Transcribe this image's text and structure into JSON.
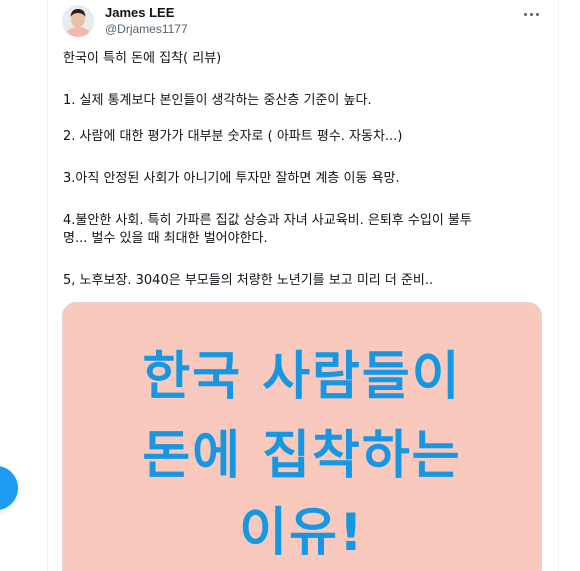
{
  "author": {
    "name": "James LEE",
    "handle": "@Drjames1177"
  },
  "tweet": {
    "title": "한국이 특히 돈에 집착( 리뷰)",
    "point1": "1. 실제 통계보다 본인들이 생각하는 중산층 기준이 높다.",
    "point2": "2. 사람에 대한 평가가 대부분 숫자로 ( 아파트 평수. 자동차...)",
    "point3": "3.아직 안정된 사회가 아니기에 투자만 잘하면 계층 이동 욕망.",
    "point4_line1": "4.불안한 사회. 특히 가파른 집값 상승과 자녀 사교육비. 은퇴후 수입이 불투",
    "point4_line2": "명...  벌수 있을 때 최대한 벌어야한다.",
    "point5": "5, 노후보장. 3040은 부모들의 처량한 노년기를 보고 미리 더 준비.."
  },
  "image": {
    "headline_line1": "한국 사람들이",
    "headline_line2": "돈에 집착하는",
    "headline_line3": "이유!",
    "background_color": "#f9c9bd",
    "text_color": "#1797e1"
  },
  "icons": {
    "more": "more-dots-icon",
    "compose": "compose-fab"
  },
  "colors": {
    "accent": "#1d9bf0",
    "secondary_text": "#536471"
  }
}
